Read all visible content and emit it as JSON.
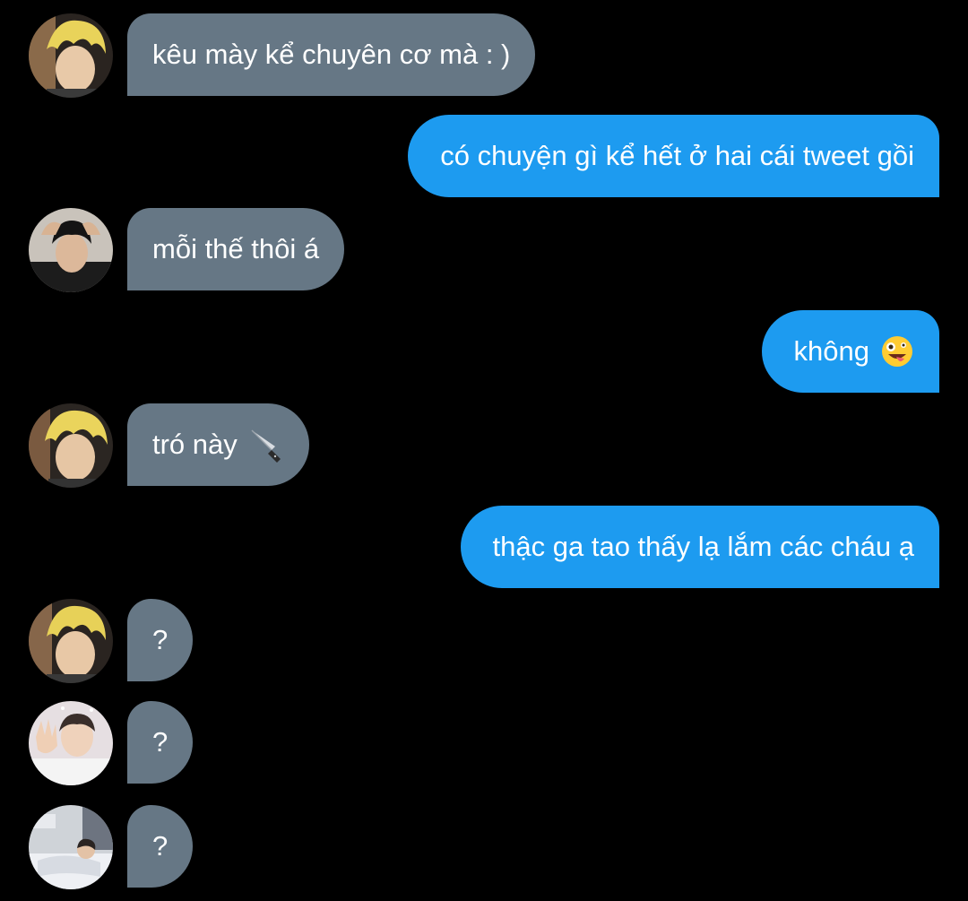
{
  "messages": [
    {
      "side": "in",
      "text": "kêu mày kể chuyên cơ mà : )",
      "avatar": "avatar-blonde-1"
    },
    {
      "side": "out",
      "text": "có chuyện gì kể hết ở hai cái tweet gồi"
    },
    {
      "side": "in",
      "text": "mỗi thế thôi á",
      "avatar": "avatar-dark-hair"
    },
    {
      "side": "out",
      "text": "không",
      "emoji": "zany-face-icon"
    },
    {
      "side": "in",
      "text": "tró này",
      "emoji": "knife-icon",
      "avatar": "avatar-blonde-2"
    },
    {
      "side": "out",
      "text": "thậc ga tao thấy lạ lắm các cháu ạ"
    },
    {
      "side": "in",
      "text": "?",
      "avatar": "avatar-blonde-3"
    },
    {
      "side": "in",
      "text": "?",
      "avatar": "avatar-waving"
    },
    {
      "side": "in",
      "text": "?",
      "avatar": "avatar-bedroom"
    }
  ],
  "colors": {
    "background": "#000000",
    "incoming_bubble": "#667785",
    "outgoing_bubble": "#1d9bf0",
    "text": "#ffffff"
  }
}
